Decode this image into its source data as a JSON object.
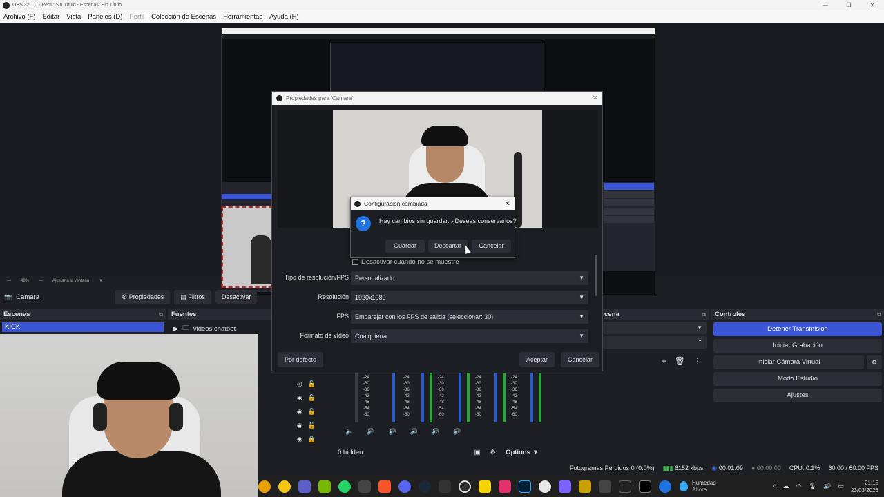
{
  "window": {
    "title": "OBS 32.1.0 - Perfil: Sin Título - Escenas: Sin Título"
  },
  "menu": {
    "file": "Archivo (F)",
    "edit": "Editar",
    "view": "Vista",
    "docks": "Paneles (D)",
    "profile": "Perfil",
    "scene_collection": "Colección de Escenas",
    "tools": "Herramientas",
    "help": "Ayuda (H)"
  },
  "zoom": {
    "level": "49%",
    "fit": "Ajustar a la ventana"
  },
  "source_toolbar": {
    "source_name": "Camara",
    "properties": "Propiedades",
    "filters": "Filtros",
    "deactivate": "Desactivar"
  },
  "scenes": {
    "header": "Escenas",
    "items": [
      "KICK"
    ]
  },
  "sources": {
    "header": "Fuentes",
    "items": [
      "videos chatbot"
    ]
  },
  "transitions": {
    "header": "cena"
  },
  "controls": {
    "header": "Controles",
    "stop_stream": "Detener Transmisión",
    "start_recording": "Iniciar Grabación",
    "start_virtual_cam": "Iniciar Cámara Virtual",
    "studio_mode": "Modo Estudio",
    "settings": "Ajustes"
  },
  "mixer": {
    "ticks": [
      "-24",
      "-30",
      "-36",
      "-42",
      "-48",
      "-54",
      "-60"
    ],
    "hidden": "0 hidden",
    "options": "Options"
  },
  "status": {
    "dropped_frames": "Fotogramas Perdidos 0 (0.0%)",
    "bitrate": "6152 kbps",
    "stream_time": "00:01:09",
    "rec_time": "00:00:00",
    "cpu": "CPU: 0.1%",
    "fps": "60.00 / 60.00 FPS"
  },
  "properties_dialog": {
    "title": "Propiedades para 'Camara'",
    "deactivate_hidden": "Desactivar cuando no se muestre",
    "resolution_type_label": "Tipo de resolución/FPS",
    "resolution_type_value": "Personalizado",
    "resolution_label": "Resolución",
    "resolution_value": "1920x1080",
    "fps_label": "FPS",
    "fps_value": "Emparejar con los FPS de salida (seleccionar: 30)",
    "video_format_label": "Formato de vídeo",
    "video_format_value": "Cualquier/a",
    "defaults": "Por defecto",
    "accept": "Aceptar",
    "cancel": "Cancelar"
  },
  "confirm_dialog": {
    "title": "Configuración cambiada",
    "message": "Hay cambios sin guardar. ¿Deseas conservarlos?",
    "save": "Guardar",
    "discard": "Descartar",
    "cancel": "Cancelar"
  },
  "taskbar": {
    "weather_title": "Humedad",
    "weather_sub": "Ahora",
    "time": "21:15",
    "date": "23/03/2026"
  },
  "colors": {
    "accent": "#3a55d5",
    "panel": "#1e1f24",
    "button": "#2c2d35"
  }
}
